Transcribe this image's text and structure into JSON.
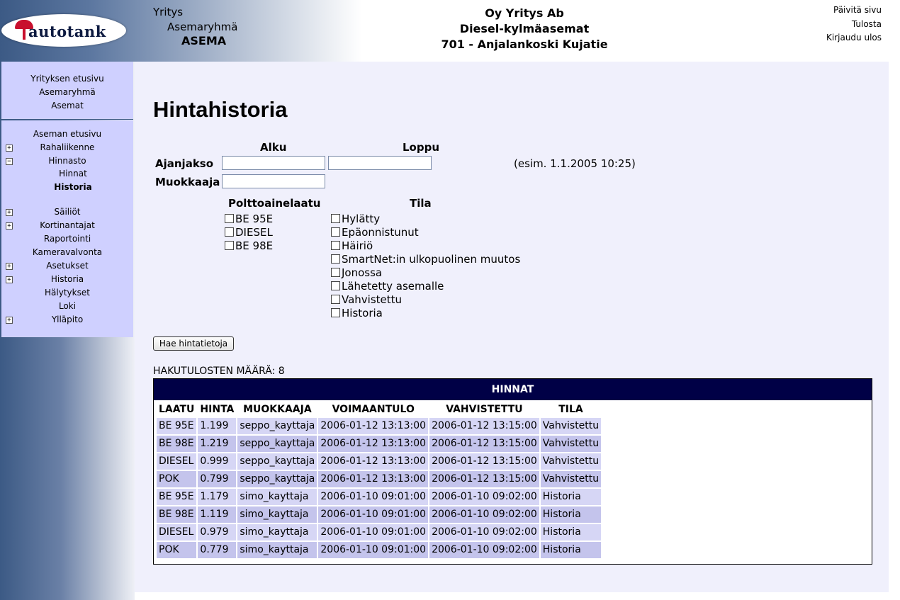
{
  "header": {
    "logo_text": "autotank",
    "company_label": "Yritys",
    "group_label": "Asemaryhmä",
    "station_label": "ASEMA",
    "company_name": "Oy Yritys Ab",
    "group_name": "Diesel-kylmäasemat",
    "station_name": "701 - Anjalankoski Kujatie",
    "links": {
      "refresh": "Päivitä sivu",
      "print": "Tulosta",
      "logout": "Kirjaudu ulos"
    }
  },
  "sidebar": {
    "top_items": [
      "Yrityksen etusivu",
      "Asemaryhmä",
      "Asemat"
    ],
    "items": [
      {
        "label": "Aseman etusivu",
        "toggle": ""
      },
      {
        "label": "Rahaliikenne",
        "toggle": "+"
      },
      {
        "label": "Hinnasto",
        "toggle": "−"
      },
      {
        "label": "Hinnat",
        "toggle": ""
      },
      {
        "label": "Historia",
        "toggle": ""
      },
      {
        "label": "Säiliöt",
        "toggle": "+"
      },
      {
        "label": "Kortinantajat",
        "toggle": "+"
      },
      {
        "label": "Raportointi",
        "toggle": ""
      },
      {
        "label": "Kameravalvonta",
        "toggle": ""
      },
      {
        "label": "Asetukset",
        "toggle": "+"
      },
      {
        "label": "Historia",
        "toggle": "+"
      },
      {
        "label": "Hälytykset",
        "toggle": ""
      },
      {
        "label": "Loki",
        "toggle": ""
      },
      {
        "label": "Ylläpito",
        "toggle": "+"
      }
    ]
  },
  "page": {
    "title": "Hintahistoria",
    "form": {
      "start_header": "Alku",
      "end_header": "Loppu",
      "period_label": "Ajanjakso",
      "editor_label": "Muokkaaja",
      "example": "(esim. 1.1.2005 10:25)",
      "start_value": "",
      "end_value": "",
      "editor_value": "",
      "fuel_header": "Polttoainelaatu",
      "state_header": "Tila",
      "fuels": [
        "BE 95E",
        "DIESEL",
        "BE 98E"
      ],
      "states": [
        "Hylätty",
        "Epäonnistunut",
        "Häiriö",
        "SmartNet:in ulkopuolinen muutos",
        "Jonossa",
        "Lähetetty asemalle",
        "Vahvistettu",
        "Historia"
      ],
      "search_button": "Hae hintatietoja"
    },
    "result_count": "HAKUTULOSTEN MÄÄRÄ: 8",
    "table": {
      "title": "HINNAT",
      "columns": [
        "LAATU",
        "HINTA",
        "MUOKKAAJA",
        "VOIMAANTULO",
        "VAHVISTETTU",
        "TILA"
      ],
      "rows": [
        [
          "BE 95E",
          "1.199",
          "seppo_kayttaja",
          "2006-01-12 13:13:00",
          "2006-01-12 13:15:00",
          "Vahvistettu"
        ],
        [
          "BE 98E",
          "1.219",
          "seppo_kayttaja",
          "2006-01-12 13:13:00",
          "2006-01-12 13:15:00",
          "Vahvistettu"
        ],
        [
          "DIESEL",
          "0.999",
          "seppo_kayttaja",
          "2006-01-12 13:13:00",
          "2006-01-12 13:15:00",
          "Vahvistettu"
        ],
        [
          "POK",
          "0.799",
          "seppo_kayttaja",
          "2006-01-12 13:13:00",
          "2006-01-12 13:15:00",
          "Vahvistettu"
        ],
        [
          "BE 95E",
          "1.179",
          "simo_kayttaja",
          "2006-01-10 09:01:00",
          "2006-01-10 09:02:00",
          "Historia"
        ],
        [
          "BE 98E",
          "1.119",
          "simo_kayttaja",
          "2006-01-10 09:01:00",
          "2006-01-10 09:02:00",
          "Historia"
        ],
        [
          "DIESEL",
          "0.979",
          "simo_kayttaja",
          "2006-01-10 09:01:00",
          "2006-01-10 09:02:00",
          "Historia"
        ],
        [
          "POK",
          "0.779",
          "simo_kayttaja",
          "2006-01-10 09:01:00",
          "2006-01-10 09:02:00",
          "Historia"
        ]
      ]
    }
  }
}
